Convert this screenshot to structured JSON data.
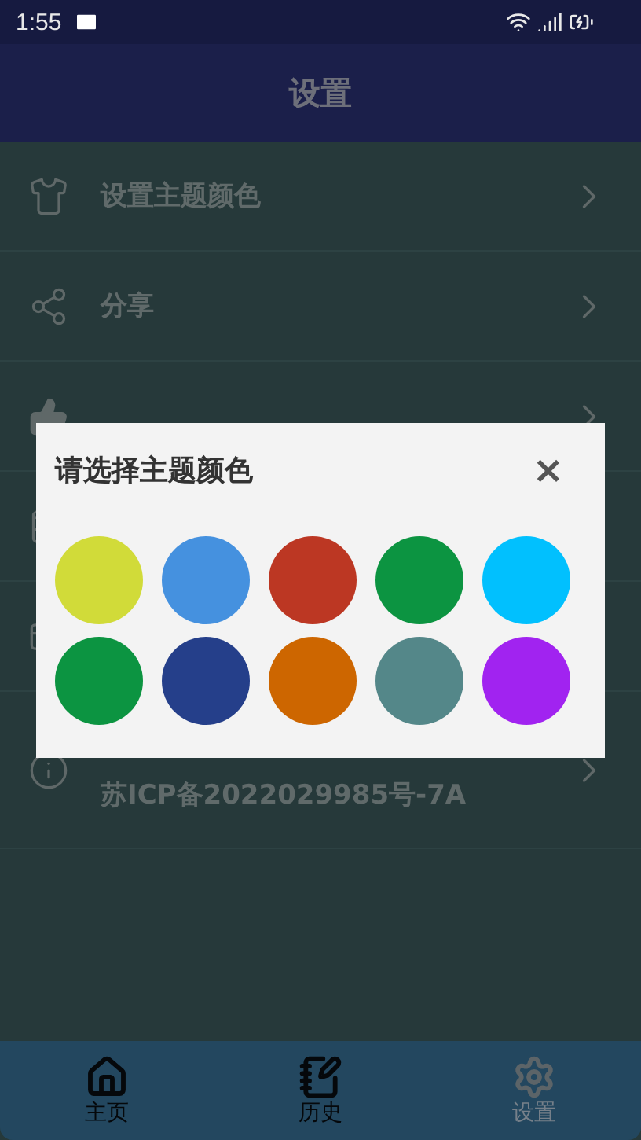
{
  "status_bar": {
    "time": "1:55"
  },
  "header": {
    "title": "设置"
  },
  "settings_rows": [
    {
      "kind": "shirt",
      "lines": [
        "设置主题颜色"
      ]
    },
    {
      "kind": "share",
      "lines": [
        "分享"
      ]
    },
    {
      "kind": "thumb",
      "lines": []
    },
    {
      "kind": "database",
      "lines": []
    },
    {
      "kind": "card",
      "lines": []
    },
    {
      "kind": "info",
      "lines": [
        "苏ICP备2022029985号-7A"
      ]
    }
  ],
  "dialog": {
    "title": "请选择主题颜色",
    "close": "×",
    "swatches": [
      {
        "color": "#d1db39"
      },
      {
        "color": "#4591df"
      },
      {
        "color": "#bc3723"
      },
      {
        "color": "#0c9441"
      },
      {
        "color": "#01c0fe"
      },
      {
        "color": "#0c9441"
      },
      {
        "color": "#253f8a"
      },
      {
        "color": "#cd6600"
      },
      {
        "color": "#548789"
      },
      {
        "color": "#a123f0"
      }
    ]
  },
  "bottom_nav": [
    {
      "kind": "home",
      "label": "主页",
      "selected": false
    },
    {
      "kind": "history",
      "label": "历史",
      "selected": false
    },
    {
      "kind": "settings",
      "label": "设置",
      "selected": true
    }
  ]
}
